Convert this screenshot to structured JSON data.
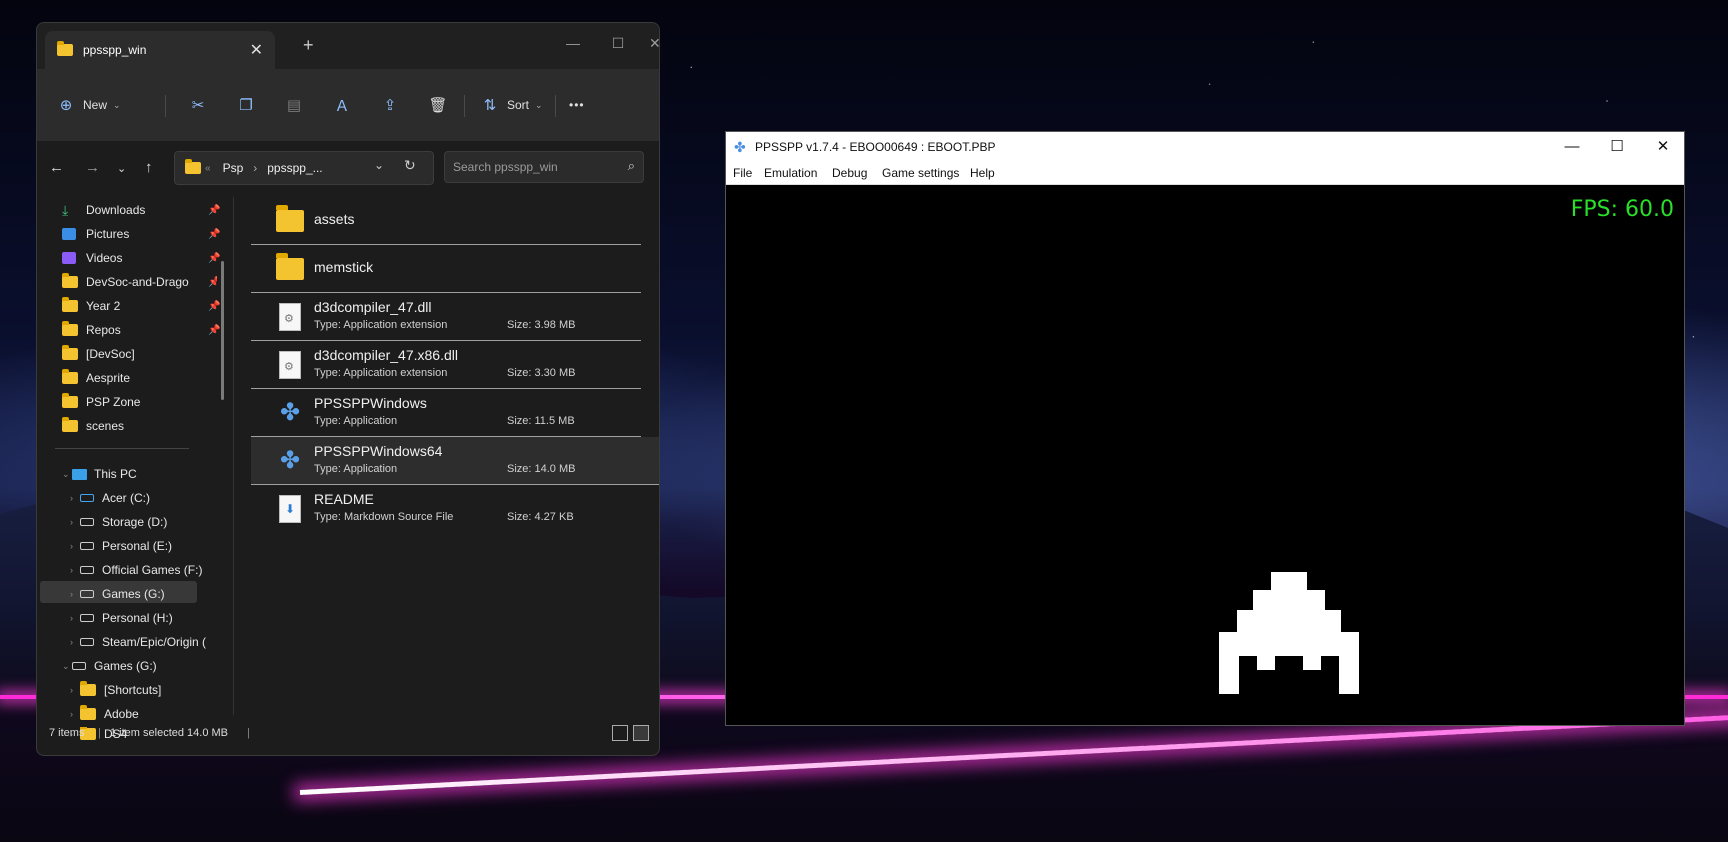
{
  "explorer": {
    "tab_title": "ppsspp_win",
    "new_tab": "+",
    "window_buttons": {
      "minimize": "—",
      "maximize": "☐",
      "close": "✕"
    },
    "toolbar": {
      "new_label": "New",
      "sort_label": "Sort",
      "more_label": "•••"
    },
    "address": {
      "overflow": "«",
      "crumbs": [
        "Psp",
        "ppsspp_..."
      ],
      "separator": "›"
    },
    "search_placeholder": "Search ppsspp_win",
    "sidebar": {
      "quick_access": [
        {
          "label": "Downloads",
          "icon": "download-icon",
          "pinned": true
        },
        {
          "label": "Pictures",
          "icon": "pictures-icon",
          "pinned": true
        },
        {
          "label": "Videos",
          "icon": "videos-icon",
          "pinned": true
        },
        {
          "label": "DevSoc-and-Drago",
          "icon": "folder-icon",
          "pinned": true
        },
        {
          "label": "Year 2",
          "icon": "folder-icon",
          "pinned": true
        },
        {
          "label": "Repos",
          "icon": "folder-icon",
          "pinned": true
        },
        {
          "label": "[DevSoc]",
          "icon": "folder-icon",
          "pinned": false
        },
        {
          "label": "Aesprite",
          "icon": "folder-icon",
          "pinned": false
        },
        {
          "label": "PSP Zone",
          "icon": "folder-icon",
          "pinned": false
        },
        {
          "label": "scenes",
          "icon": "folder-icon",
          "pinned": false
        }
      ],
      "this_pc": "This PC",
      "drives": [
        {
          "label": "Acer (C:)",
          "icon": "windows-drive-icon"
        },
        {
          "label": "Storage (D:)",
          "icon": "drive-icon"
        },
        {
          "label": "Personal (E:)",
          "icon": "drive-icon"
        },
        {
          "label": "Official Games (F:)",
          "icon": "drive-icon"
        },
        {
          "label": "Games (G:)",
          "icon": "drive-icon",
          "selected": true
        },
        {
          "label": "Personal (H:)",
          "icon": "drive-icon"
        },
        {
          "label": "Steam/Epic/Origin (",
          "icon": "drive-icon"
        }
      ],
      "games_drive": "Games (G:)",
      "games_children": [
        "[Shortcuts]",
        "Adobe",
        "DS4"
      ]
    },
    "files": [
      {
        "name": "assets",
        "kind": "folder"
      },
      {
        "name": "memstick",
        "kind": "folder"
      },
      {
        "name": "d3dcompiler_47.dll",
        "kind": "dll",
        "type": "Type: Application extension",
        "size": "Size: 3.98 MB"
      },
      {
        "name": "d3dcompiler_47.x86.dll",
        "kind": "dll",
        "type": "Type: Application extension",
        "size": "Size: 3.30 MB"
      },
      {
        "name": "PPSSPPWindows",
        "kind": "app",
        "type": "Type: Application",
        "size": "Size: 11.5 MB"
      },
      {
        "name": "PPSSPPWindows64",
        "kind": "app",
        "type": "Type: Application",
        "size": "Size: 14.0 MB",
        "selected": true
      },
      {
        "name": "README",
        "kind": "md",
        "type": "Type: Markdown Source File",
        "size": "Size: 4.27 KB"
      }
    ],
    "status": {
      "items": "7 items",
      "selected": "1 item selected  14.0 MB"
    }
  },
  "ppsspp": {
    "title": "PPSSPP v1.7.4 - EBOO00649 : EBOOT.PBP",
    "menu": [
      "File",
      "Emulation",
      "Debug",
      "Game settings",
      "Help"
    ],
    "fps": "FPS: 60.0"
  }
}
